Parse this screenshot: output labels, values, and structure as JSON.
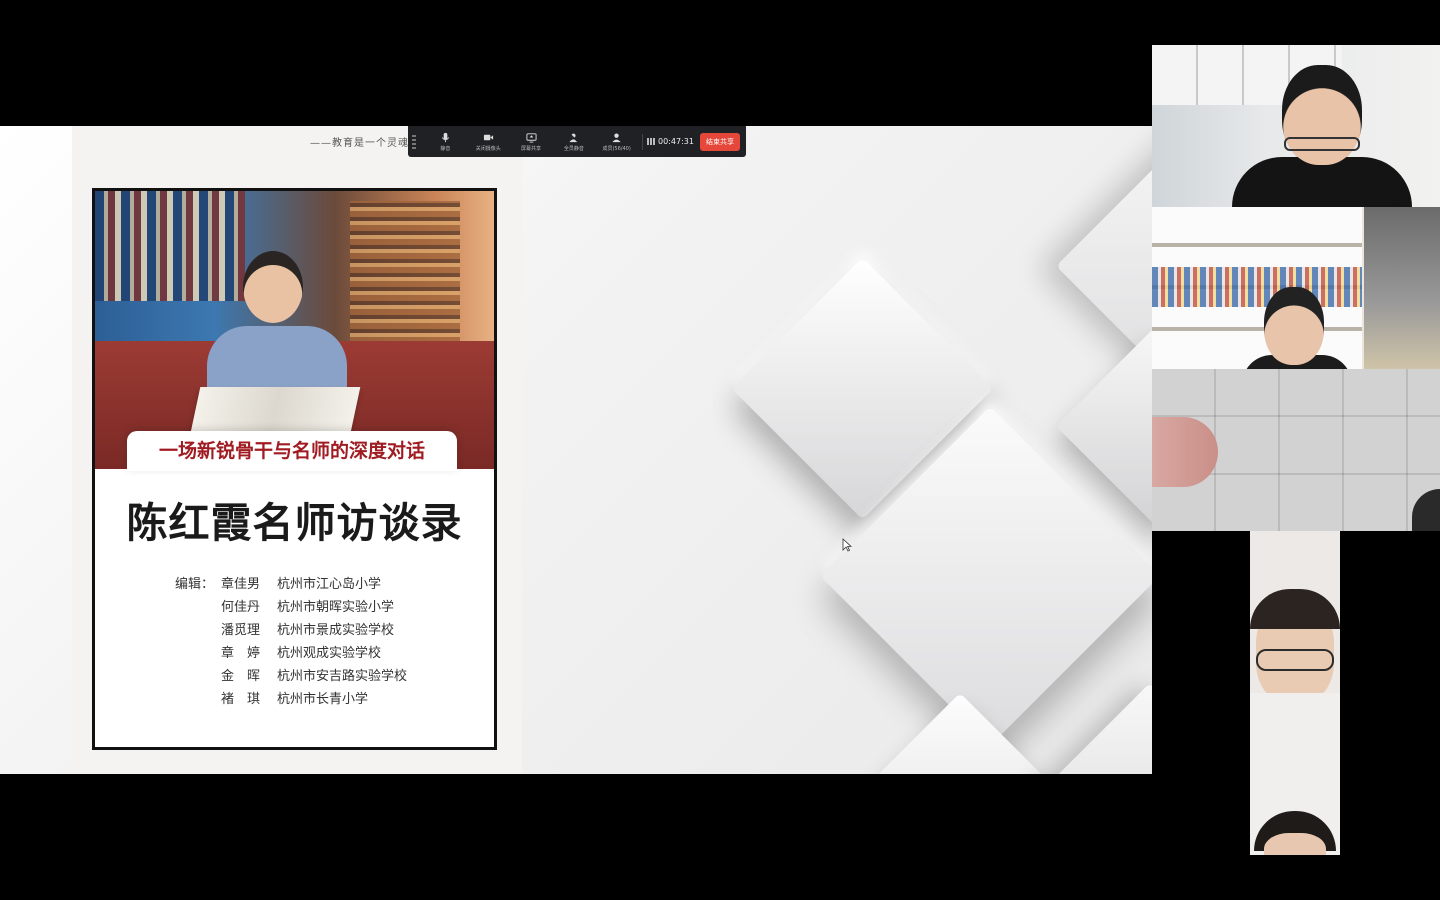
{
  "slide": {
    "quote": "——教育是一个灵魂",
    "cover": {
      "tagline": "一场新锐骨干与名师的深度对话",
      "title": "陈红霞名师访谈录",
      "credits_label": "编辑：",
      "credits": [
        {
          "name": "章佳男",
          "school": "杭州市江心岛小学"
        },
        {
          "name": "何佳丹",
          "school": "杭州市朝晖实验小学"
        },
        {
          "name": "潘觅理",
          "school": "杭州市景成实验学校"
        },
        {
          "name": "章　婷",
          "school": "杭州观成实验学校"
        },
        {
          "name": "金　晖",
          "school": "杭州市安吉路实验学校"
        },
        {
          "name": "褚　琪",
          "school": "杭州市长青小学"
        }
      ]
    }
  },
  "toolbar": {
    "buttons": [
      {
        "label": "静音",
        "icon": "microphone-icon"
      },
      {
        "label": "关闭摄像头",
        "icon": "camera-icon"
      },
      {
        "label": "屏幕共享",
        "icon": "screen-share-icon"
      },
      {
        "label": "全员静音",
        "icon": "mute-all-icon"
      },
      {
        "label": "成员(56/40)",
        "icon": "members-icon"
      }
    ],
    "timer": "00:47:31",
    "end_share_label": "结束共享"
  },
  "participants": [
    {
      "id": "participant-1"
    },
    {
      "id": "participant-2"
    },
    {
      "id": "participant-3"
    },
    {
      "id": "participant-4"
    },
    {
      "id": "participant-5"
    }
  ],
  "colors": {
    "end_share": "#e5483b",
    "tagline": "#a01c22",
    "toolbar_bg": "#202124"
  }
}
